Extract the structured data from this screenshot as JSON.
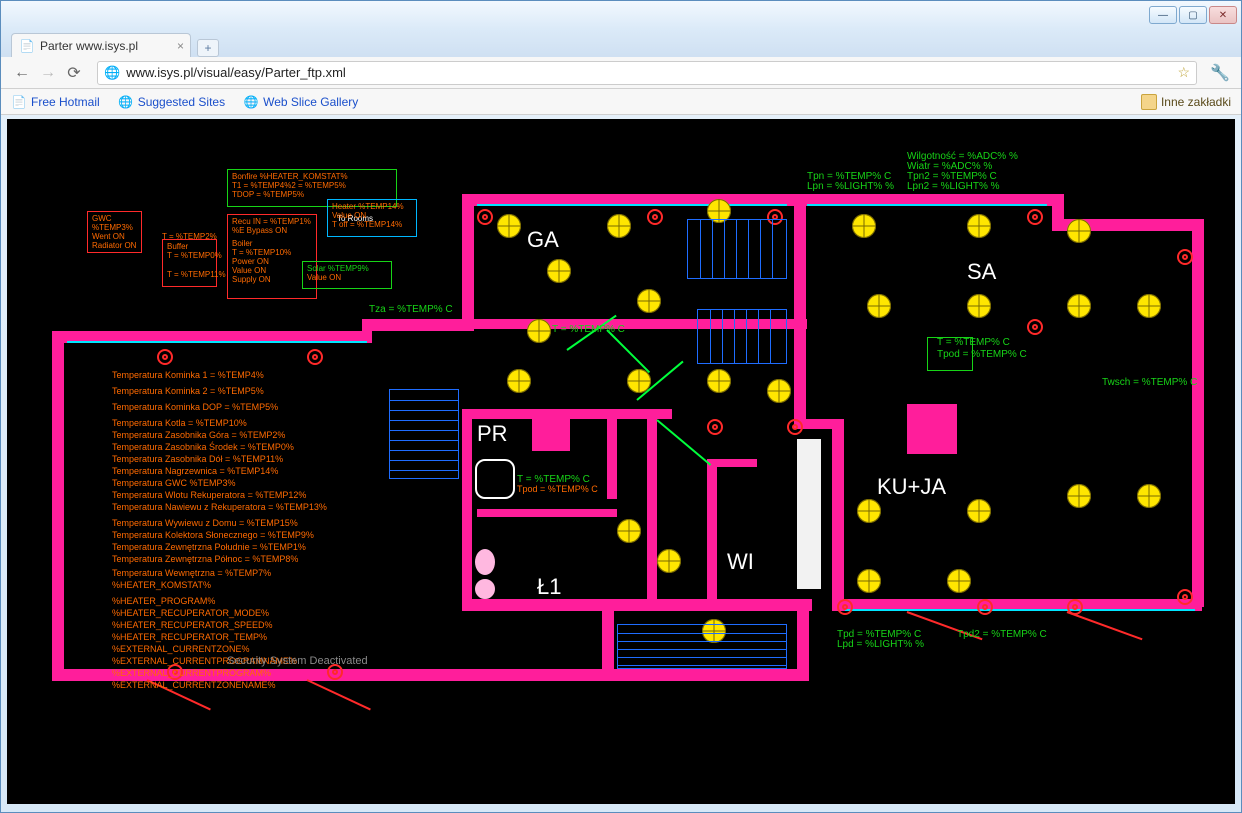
{
  "window": {
    "title": "Parter www.isys.pl",
    "min": "—",
    "max": "▢",
    "close": "✕"
  },
  "toolbar": {
    "url": "www.isys.pl/visual/easy/Parter_ftp.xml"
  },
  "bookmarks": {
    "a": "Free Hotmail",
    "b": "Suggested Sites",
    "c": "Web Slice Gallery",
    "folder": "Inne zakładki"
  },
  "rooms": {
    "ga": "GA",
    "sa": "SA",
    "pr": "PR",
    "l1": "Ł1",
    "wi": "WI",
    "ku": "KU+JA"
  },
  "topRight": {
    "l1": "Wilgotność = %ADC% %",
    "l2": "Wiatr = %ADC% %",
    "l3": "Tpn2 = %TEMP% C",
    "l4": "Lpn2 = %LIGHT% %",
    "l5": "Tpn = %TEMP% C",
    "l6": "Lpn = %LIGHT% %"
  },
  "midRight": {
    "t": "T = %TEMP% C",
    "tpod": "Tpod = %TEMP% C",
    "twsch": "Twsch = %TEMP% C"
  },
  "bottomRight": {
    "tpd": "Tpd = %TEMP% C",
    "lpd": "Lpd = %LIGHT% %",
    "tpd2": "Tpd2 = %TEMP% C"
  },
  "tza": "Tza = %TEMP% C",
  "tmid": "T = %TEMP% C",
  "prT": "T = %TEMP% C",
  "prTpod": "Tpod = %TEMP% C",
  "bonfire": {
    "title": "Bonfire %HEATER_KOMSTAT%",
    "l1": "T1 = %TEMP4%2 = %TEMP5%",
    "l2": "TDOP = %TEMP5%",
    "toRooms": "To Rooms"
  },
  "heater14": {
    "title": "Heater %TEMP14%",
    "v": "Value ON",
    "t": "T off = %TEMP14%"
  },
  "recu": {
    "title": "Recu IN = %TEMP1%",
    "bypass": "%E Bypass ON"
  },
  "boiler": {
    "title": "Boiler",
    "t": "T = %TEMP10%",
    "power": "Power ON",
    "value": "Value ON",
    "supply": "Supply ON"
  },
  "solar": {
    "title": "Solar %TEMP9%",
    "v": "Value ON"
  },
  "gwc": {
    "title": "GWC",
    "l1": "%TEMP3%",
    "l2": "Went ON",
    "l3": "Radiator ON"
  },
  "buff": {
    "title": "Buffer",
    "t": "T = %TEMP0%",
    "t2": "T = %TEMP11%"
  },
  "sidebar": {
    "l1": "Temperatura Kominka 1 = %TEMP4%",
    "l2": "Temperatura Kominka 2 = %TEMP5%",
    "l3": "Temperatura Kominka DOP = %TEMP5%",
    "l4": "Temperatura Kotla = %TEMP10%",
    "l5": "Temperatura Zasobnika Góra = %TEMP2%",
    "l6": "Temperatura Zasobnika Środek = %TEMP0%",
    "l7": "Temperatura Zasobnika Dół = %TEMP11%",
    "l8": "Temperatura Nagrzewnica = %TEMP14%",
    "l9": "Temperatura GWC %TEMP3%",
    "l10": "Temperatura Wlotu Rekuperatora = %TEMP12%",
    "l11": "Temperatura Nawiewu z Rekuperatora = %TEMP13%",
    "l12": "Temperatura Wywiewu z Domu = %TEMP15%",
    "l13": "Temperatura Kolektora Słonecznego = %TEMP9%",
    "l14": "Temperatura Zewnętrzna Południe = %TEMP1%",
    "l15": "Temperatura Zewnętrzna Północ = %TEMP8%",
    "l16": "Temperatura Wewnętrzna = %TEMP7%",
    "l17": "%HEATER_KOMSTAT%",
    "l18": "%HEATER_PROGRAM%",
    "l19": "%HEATER_RECUPERATOR_MODE%",
    "l20": "%HEATER_RECUPERATOR_SPEED%",
    "l21": "%HEATER_RECUPERATOR_TEMP%",
    "l22": "%EXTERNAL_CURRENTZONE%",
    "l23": "%EXTERNAL_CURRENTPROGRAMNAME%",
    "l24": "%EXTERNAL_CURRENTPROGRAM%",
    "l25": "%EXTERNAL_CURRENTZONENAME%"
  },
  "security": "Security System Deactivated"
}
